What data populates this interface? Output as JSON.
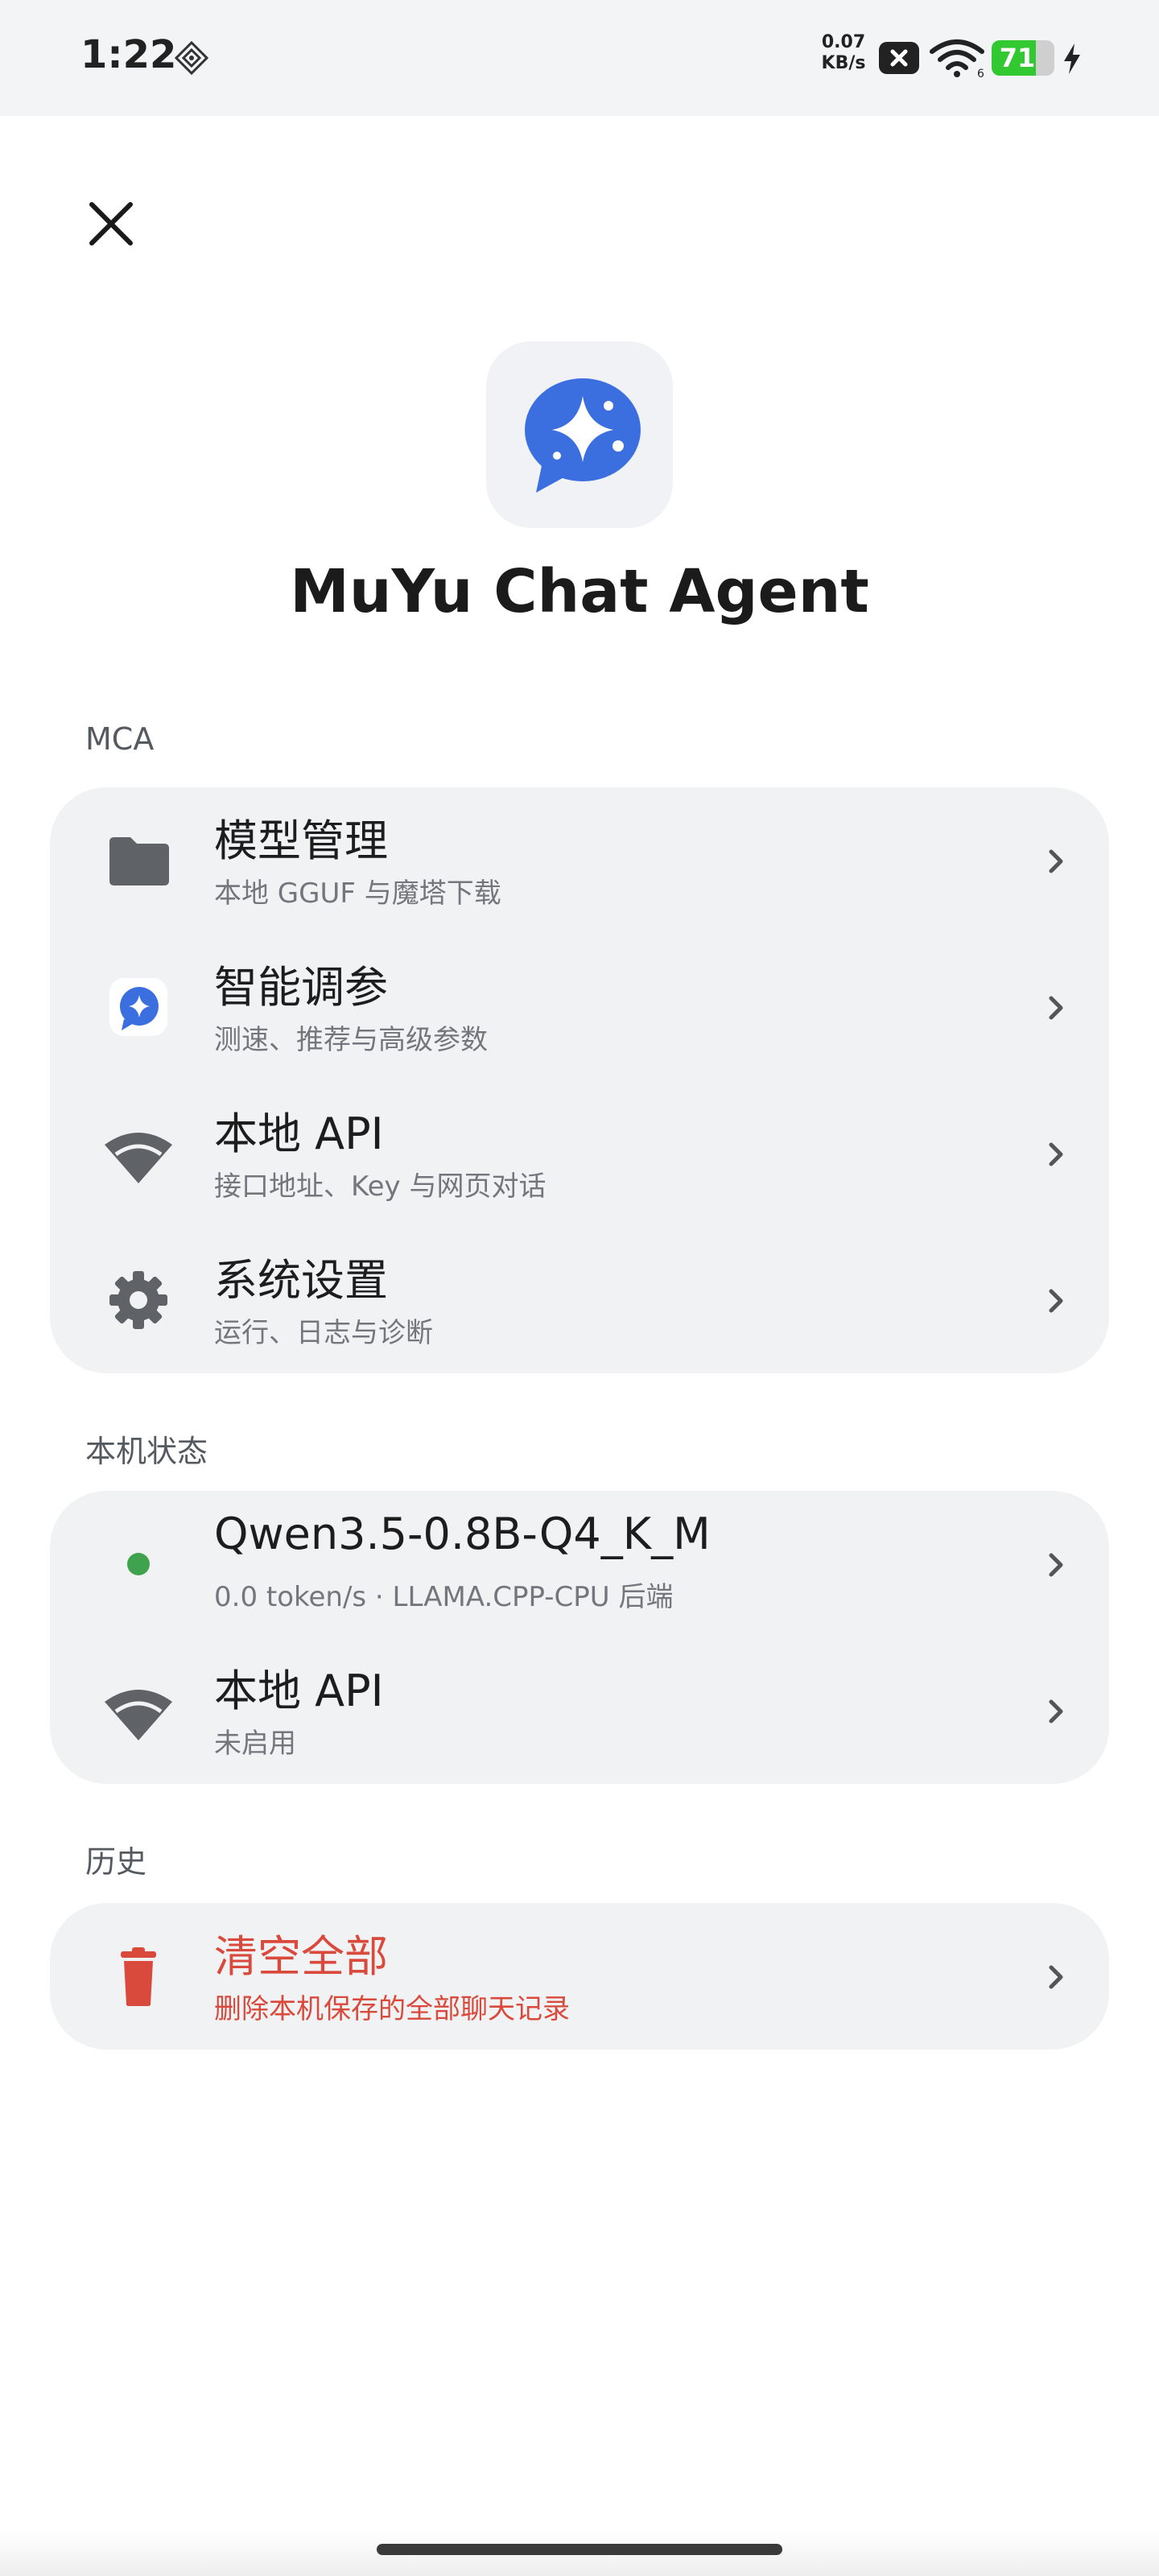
{
  "status_bar": {
    "time": "1:22",
    "net_speed_value": "0.07",
    "net_speed_unit": "KB/s",
    "battery_percent": "71",
    "battery_level": 0.71,
    "icons": [
      "signal-diamond-icon",
      "no-sim-icon",
      "wifi-icon",
      "battery-icon",
      "charging-bolt-icon"
    ]
  },
  "header": {
    "close_icon": "close-icon",
    "app_icon": "sparkle-chat-bubble-icon",
    "app_title": "MuYu Chat Agent"
  },
  "sections": {
    "mca": {
      "label": "MCA",
      "items": [
        {
          "title": "模型管理",
          "subtitle": "本地 GGUF 与魔塔下载",
          "icon": "folder-icon"
        },
        {
          "title": "智能调参",
          "subtitle": "测速、推荐与高级参数",
          "icon": "sparkle-chat-icon"
        },
        {
          "title": "本地 API",
          "subtitle": "接口地址、Key 与网页对话",
          "icon": "wifi-icon"
        },
        {
          "title": "系统设置",
          "subtitle": "运行、日志与诊断",
          "icon": "gear-icon"
        }
      ]
    },
    "device": {
      "label": "本机状态",
      "items": [
        {
          "title": "Qwen3.5-0.8B-Q4_K_M",
          "subtitle": "0.0 token/s · LLAMA.CPP-CPU 后端",
          "icon": "status-dot-icon"
        },
        {
          "title": "本地 API",
          "subtitle": "未启用",
          "icon": "wifi-icon"
        }
      ]
    },
    "history": {
      "label": "历史",
      "items": [
        {
          "title": "清空全部",
          "subtitle": "删除本机保存的全部聊天记录",
          "icon": "trash-icon"
        }
      ]
    }
  },
  "colors": {
    "accent_blue": "#3b6fe0",
    "danger_red": "#d94a3c",
    "status_green": "#3fa34d",
    "card_bg": "#f1f2f4",
    "icon_gray": "#5f6368"
  }
}
